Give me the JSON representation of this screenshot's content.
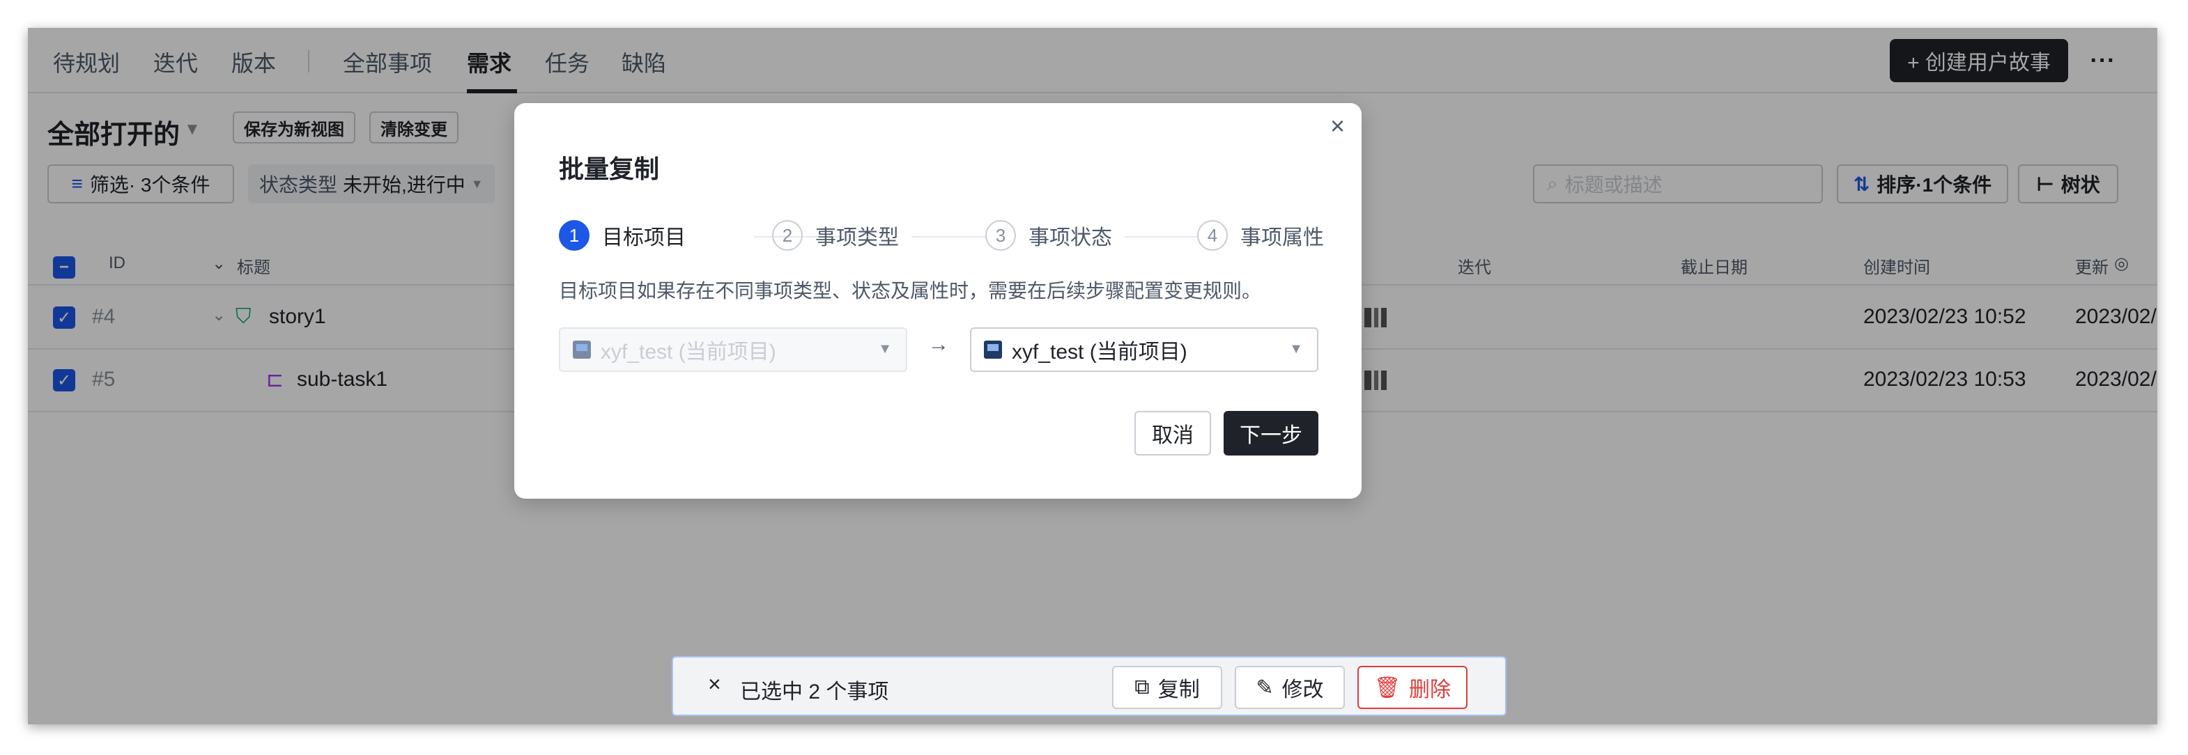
{
  "nav": {
    "items": [
      "待规划",
      "迭代",
      "版本",
      "全部事项",
      "需求",
      "任务",
      "缺陷"
    ],
    "create_label": "+ 创建用户故事",
    "more_label": "···"
  },
  "toolbar": {
    "view_title": "全部打开的",
    "save_view": "保存为新视图",
    "clear_changes": "清除变更",
    "filter_label": "筛选· 3个条件",
    "status_key": "状态类型",
    "status_value": "未开始,进行中",
    "search_placeholder": "标题或描述",
    "sort_label": "排序·1个条件",
    "tree_label": "树状"
  },
  "table": {
    "headers": [
      "ID",
      "标题",
      "迭代",
      "截止日期",
      "创建时间",
      "更新"
    ],
    "rows": [
      {
        "id": "#4",
        "title": "story1",
        "created": "2023/02/23 10:52",
        "updated": "2023/02/"
      },
      {
        "id": "#5",
        "title": "sub-task1",
        "created": "2023/02/23 10:53",
        "updated": "2023/02/"
      }
    ]
  },
  "selection_bar": {
    "text": "已选中 2 个事项",
    "copy": "复制",
    "edit": "修改",
    "delete": "删除"
  },
  "modal": {
    "title": "批量复制",
    "steps": [
      {
        "num": "1",
        "label": "目标项目"
      },
      {
        "num": "2",
        "label": "事项类型"
      },
      {
        "num": "3",
        "label": "事项状态"
      },
      {
        "num": "4",
        "label": "事项属性"
      }
    ],
    "description": "目标项目如果存在不同事项类型、状态及属性时，需要在后续步骤配置变更规则。",
    "source_project": "xyf_test (当前项目)",
    "target_project": "xyf_test (当前项目)",
    "cancel": "取消",
    "next": "下一步"
  },
  "colors": {
    "accent": "#1d57e8",
    "dark": "#1f2329",
    "danger": "#e03b3b"
  }
}
